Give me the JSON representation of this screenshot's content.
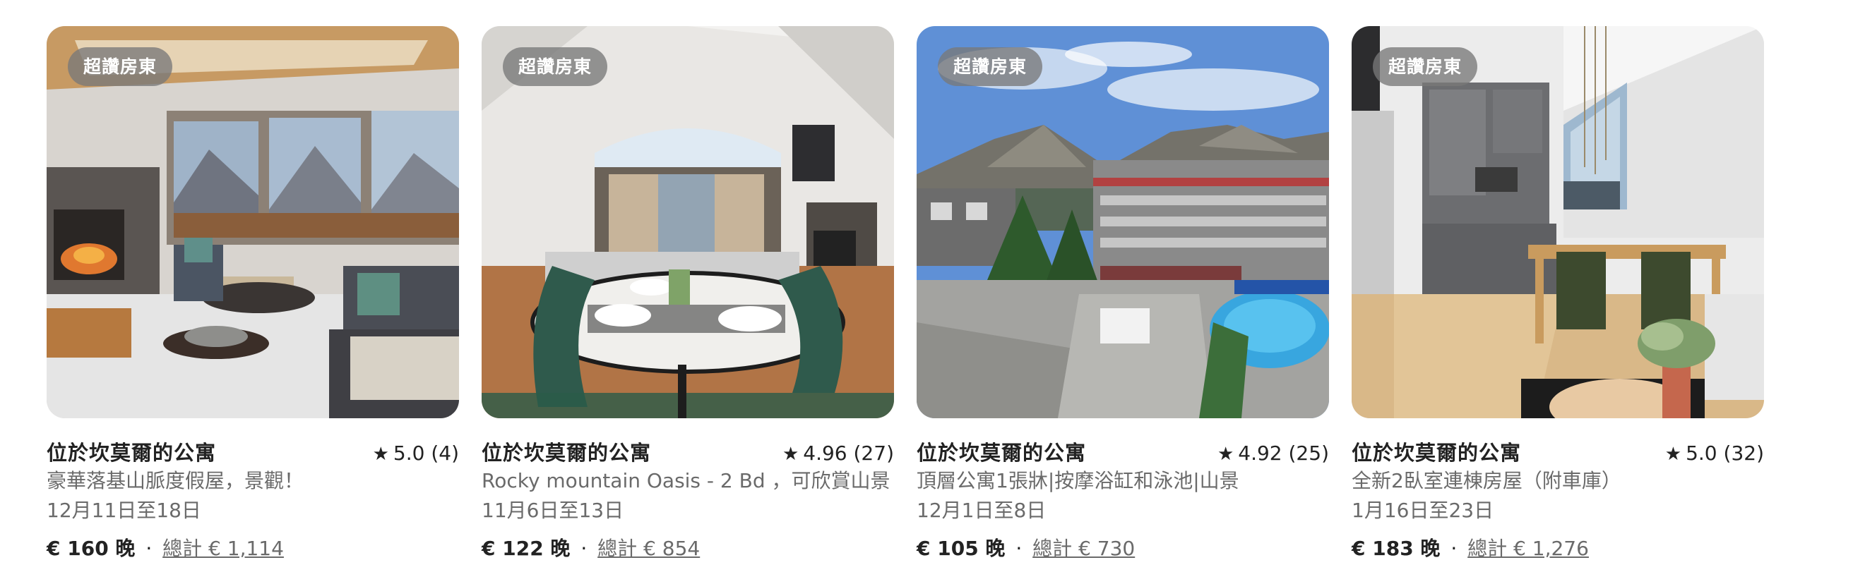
{
  "listings": [
    {
      "badge": "超讚房東",
      "title": "位於坎莫爾的公寓",
      "rating": "5.0 (4)",
      "description": "豪華落基山脈度假屋，景觀！",
      "dates": "12月11日至18日",
      "price_nightly": "€ 160 晚",
      "separator": "·",
      "price_total": "總計 € 1,114",
      "icon": "star-icon"
    },
    {
      "badge": "超讚房東",
      "title": "位於坎莫爾的公寓",
      "rating": "4.96 (27)",
      "description": "Rocky mountain Oasis - 2 Bd ，可欣賞山景",
      "dates": "11月6日至13日",
      "price_nightly": "€ 122 晚",
      "separator": "·",
      "price_total": "總計 € 854",
      "icon": "star-icon"
    },
    {
      "badge": "超讚房東",
      "title": "位於坎莫爾的公寓",
      "rating": "4.92 (25)",
      "description": "頂層公寓1張牀|按摩浴缸和泳池|山景",
      "dates": "12月1日至8日",
      "price_nightly": "€ 105 晚",
      "separator": "·",
      "price_total": "總計 € 730",
      "icon": "star-icon"
    },
    {
      "badge": "超讚房東",
      "title": "位於坎莫爾的公寓",
      "rating": "5.0 (32)",
      "description": "全新2臥室連棟房屋（附車庫）",
      "dates": "1月16日至23日",
      "price_nightly": "€ 183 晚",
      "separator": "·",
      "price_total": "總計 € 1,276",
      "icon": "star-icon"
    }
  ]
}
